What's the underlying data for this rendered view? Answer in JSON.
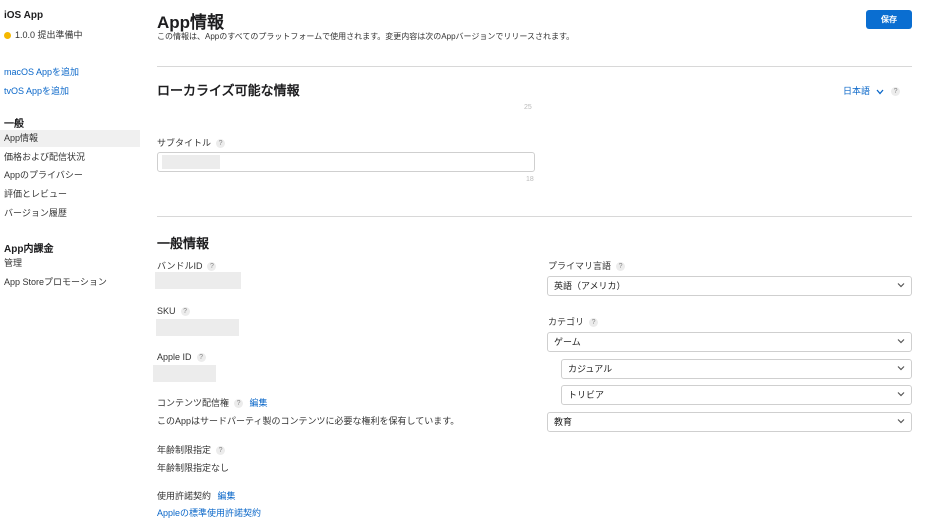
{
  "sidebar": {
    "app_name": "iOS App",
    "version_status": "1.0.0 提出準備中",
    "add_macos": "macOS Appを追加",
    "add_tvos": "tvOS Appを追加",
    "general_heading": "一般",
    "general_items": [
      "App情報",
      "価格および配信状況",
      "Appのプライバシー",
      "評価とレビュー",
      "バージョン履歴"
    ],
    "iap_heading": "App内課金",
    "iap_items": [
      "管理",
      "App Storeプロモーション"
    ]
  },
  "header": {
    "title": "App情報",
    "description": "この情報は、Appのすべてのプラットフォームで使用されます。変更内容は次のAppバージョンでリリースされます。",
    "save_label": "保存"
  },
  "localizable": {
    "heading": "ローカライズ可能な情報",
    "language": "日本語",
    "name_counter": "25",
    "subtitle_label": "サブタイトル",
    "subtitle_counter": "18"
  },
  "general_info": {
    "heading": "一般情報",
    "bundle_id_label": "バンドルID",
    "sku_label": "SKU",
    "apple_id_label": "Apple ID",
    "content_rights_label": "コンテンツ配信権",
    "content_rights_edit": "編集",
    "content_rights_value": "このAppはサードパーティ製のコンテンツに必要な権利を保有しています。",
    "age_rating_label": "年齢制限指定",
    "age_rating_value": "年齢制限指定なし",
    "license_label": "使用許諾契約",
    "license_edit": "編集",
    "license_link": "Appleの標準使用許諾契約",
    "primary_language_label": "プライマリ言語",
    "primary_language_value": "英語（アメリカ）",
    "category_label": "カテゴリ",
    "primary_category": "ゲーム",
    "subcategory_1": "カジュアル",
    "subcategory_2": "トリビア",
    "secondary_category": "教育"
  },
  "colors": {
    "accent": "#0a6ed1",
    "status_dot": "#f5b800"
  }
}
